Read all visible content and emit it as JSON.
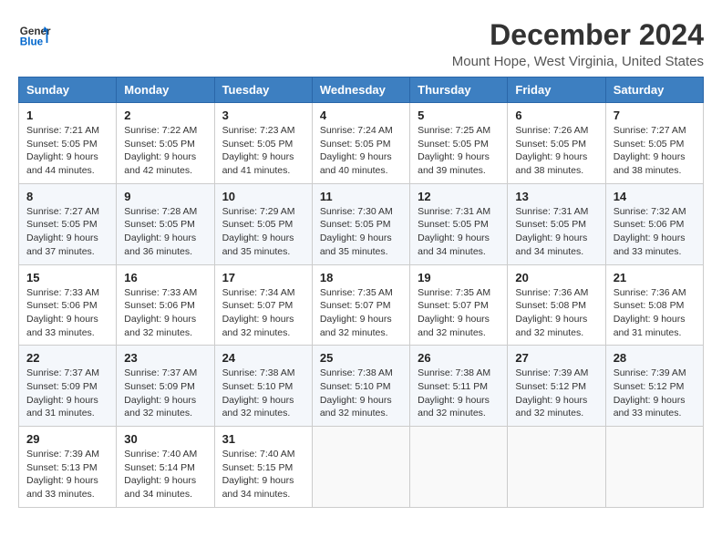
{
  "header": {
    "logo_line1": "General",
    "logo_line2": "Blue",
    "month": "December 2024",
    "location": "Mount Hope, West Virginia, United States"
  },
  "days_of_week": [
    "Sunday",
    "Monday",
    "Tuesday",
    "Wednesday",
    "Thursday",
    "Friday",
    "Saturday"
  ],
  "weeks": [
    [
      {
        "day": "1",
        "sunrise": "7:21 AM",
        "sunset": "5:05 PM",
        "daylight": "9 hours and 44 minutes."
      },
      {
        "day": "2",
        "sunrise": "7:22 AM",
        "sunset": "5:05 PM",
        "daylight": "9 hours and 42 minutes."
      },
      {
        "day": "3",
        "sunrise": "7:23 AM",
        "sunset": "5:05 PM",
        "daylight": "9 hours and 41 minutes."
      },
      {
        "day": "4",
        "sunrise": "7:24 AM",
        "sunset": "5:05 PM",
        "daylight": "9 hours and 40 minutes."
      },
      {
        "day": "5",
        "sunrise": "7:25 AM",
        "sunset": "5:05 PM",
        "daylight": "9 hours and 39 minutes."
      },
      {
        "day": "6",
        "sunrise": "7:26 AM",
        "sunset": "5:05 PM",
        "daylight": "9 hours and 38 minutes."
      },
      {
        "day": "7",
        "sunrise": "7:27 AM",
        "sunset": "5:05 PM",
        "daylight": "9 hours and 38 minutes."
      }
    ],
    [
      {
        "day": "8",
        "sunrise": "7:27 AM",
        "sunset": "5:05 PM",
        "daylight": "9 hours and 37 minutes."
      },
      {
        "day": "9",
        "sunrise": "7:28 AM",
        "sunset": "5:05 PM",
        "daylight": "9 hours and 36 minutes."
      },
      {
        "day": "10",
        "sunrise": "7:29 AM",
        "sunset": "5:05 PM",
        "daylight": "9 hours and 35 minutes."
      },
      {
        "day": "11",
        "sunrise": "7:30 AM",
        "sunset": "5:05 PM",
        "daylight": "9 hours and 35 minutes."
      },
      {
        "day": "12",
        "sunrise": "7:31 AM",
        "sunset": "5:05 PM",
        "daylight": "9 hours and 34 minutes."
      },
      {
        "day": "13",
        "sunrise": "7:31 AM",
        "sunset": "5:05 PM",
        "daylight": "9 hours and 34 minutes."
      },
      {
        "day": "14",
        "sunrise": "7:32 AM",
        "sunset": "5:06 PM",
        "daylight": "9 hours and 33 minutes."
      }
    ],
    [
      {
        "day": "15",
        "sunrise": "7:33 AM",
        "sunset": "5:06 PM",
        "daylight": "9 hours and 33 minutes."
      },
      {
        "day": "16",
        "sunrise": "7:33 AM",
        "sunset": "5:06 PM",
        "daylight": "9 hours and 32 minutes."
      },
      {
        "day": "17",
        "sunrise": "7:34 AM",
        "sunset": "5:07 PM",
        "daylight": "9 hours and 32 minutes."
      },
      {
        "day": "18",
        "sunrise": "7:35 AM",
        "sunset": "5:07 PM",
        "daylight": "9 hours and 32 minutes."
      },
      {
        "day": "19",
        "sunrise": "7:35 AM",
        "sunset": "5:07 PM",
        "daylight": "9 hours and 32 minutes."
      },
      {
        "day": "20",
        "sunrise": "7:36 AM",
        "sunset": "5:08 PM",
        "daylight": "9 hours and 32 minutes."
      },
      {
        "day": "21",
        "sunrise": "7:36 AM",
        "sunset": "5:08 PM",
        "daylight": "9 hours and 31 minutes."
      }
    ],
    [
      {
        "day": "22",
        "sunrise": "7:37 AM",
        "sunset": "5:09 PM",
        "daylight": "9 hours and 31 minutes."
      },
      {
        "day": "23",
        "sunrise": "7:37 AM",
        "sunset": "5:09 PM",
        "daylight": "9 hours and 32 minutes."
      },
      {
        "day": "24",
        "sunrise": "7:38 AM",
        "sunset": "5:10 PM",
        "daylight": "9 hours and 32 minutes."
      },
      {
        "day": "25",
        "sunrise": "7:38 AM",
        "sunset": "5:10 PM",
        "daylight": "9 hours and 32 minutes."
      },
      {
        "day": "26",
        "sunrise": "7:38 AM",
        "sunset": "5:11 PM",
        "daylight": "9 hours and 32 minutes."
      },
      {
        "day": "27",
        "sunrise": "7:39 AM",
        "sunset": "5:12 PM",
        "daylight": "9 hours and 32 minutes."
      },
      {
        "day": "28",
        "sunrise": "7:39 AM",
        "sunset": "5:12 PM",
        "daylight": "9 hours and 33 minutes."
      }
    ],
    [
      {
        "day": "29",
        "sunrise": "7:39 AM",
        "sunset": "5:13 PM",
        "daylight": "9 hours and 33 minutes."
      },
      {
        "day": "30",
        "sunrise": "7:40 AM",
        "sunset": "5:14 PM",
        "daylight": "9 hours and 34 minutes."
      },
      {
        "day": "31",
        "sunrise": "7:40 AM",
        "sunset": "5:15 PM",
        "daylight": "9 hours and 34 minutes."
      },
      null,
      null,
      null,
      null
    ]
  ],
  "labels": {
    "sunrise": "Sunrise:",
    "sunset": "Sunset:",
    "daylight": "Daylight:"
  }
}
